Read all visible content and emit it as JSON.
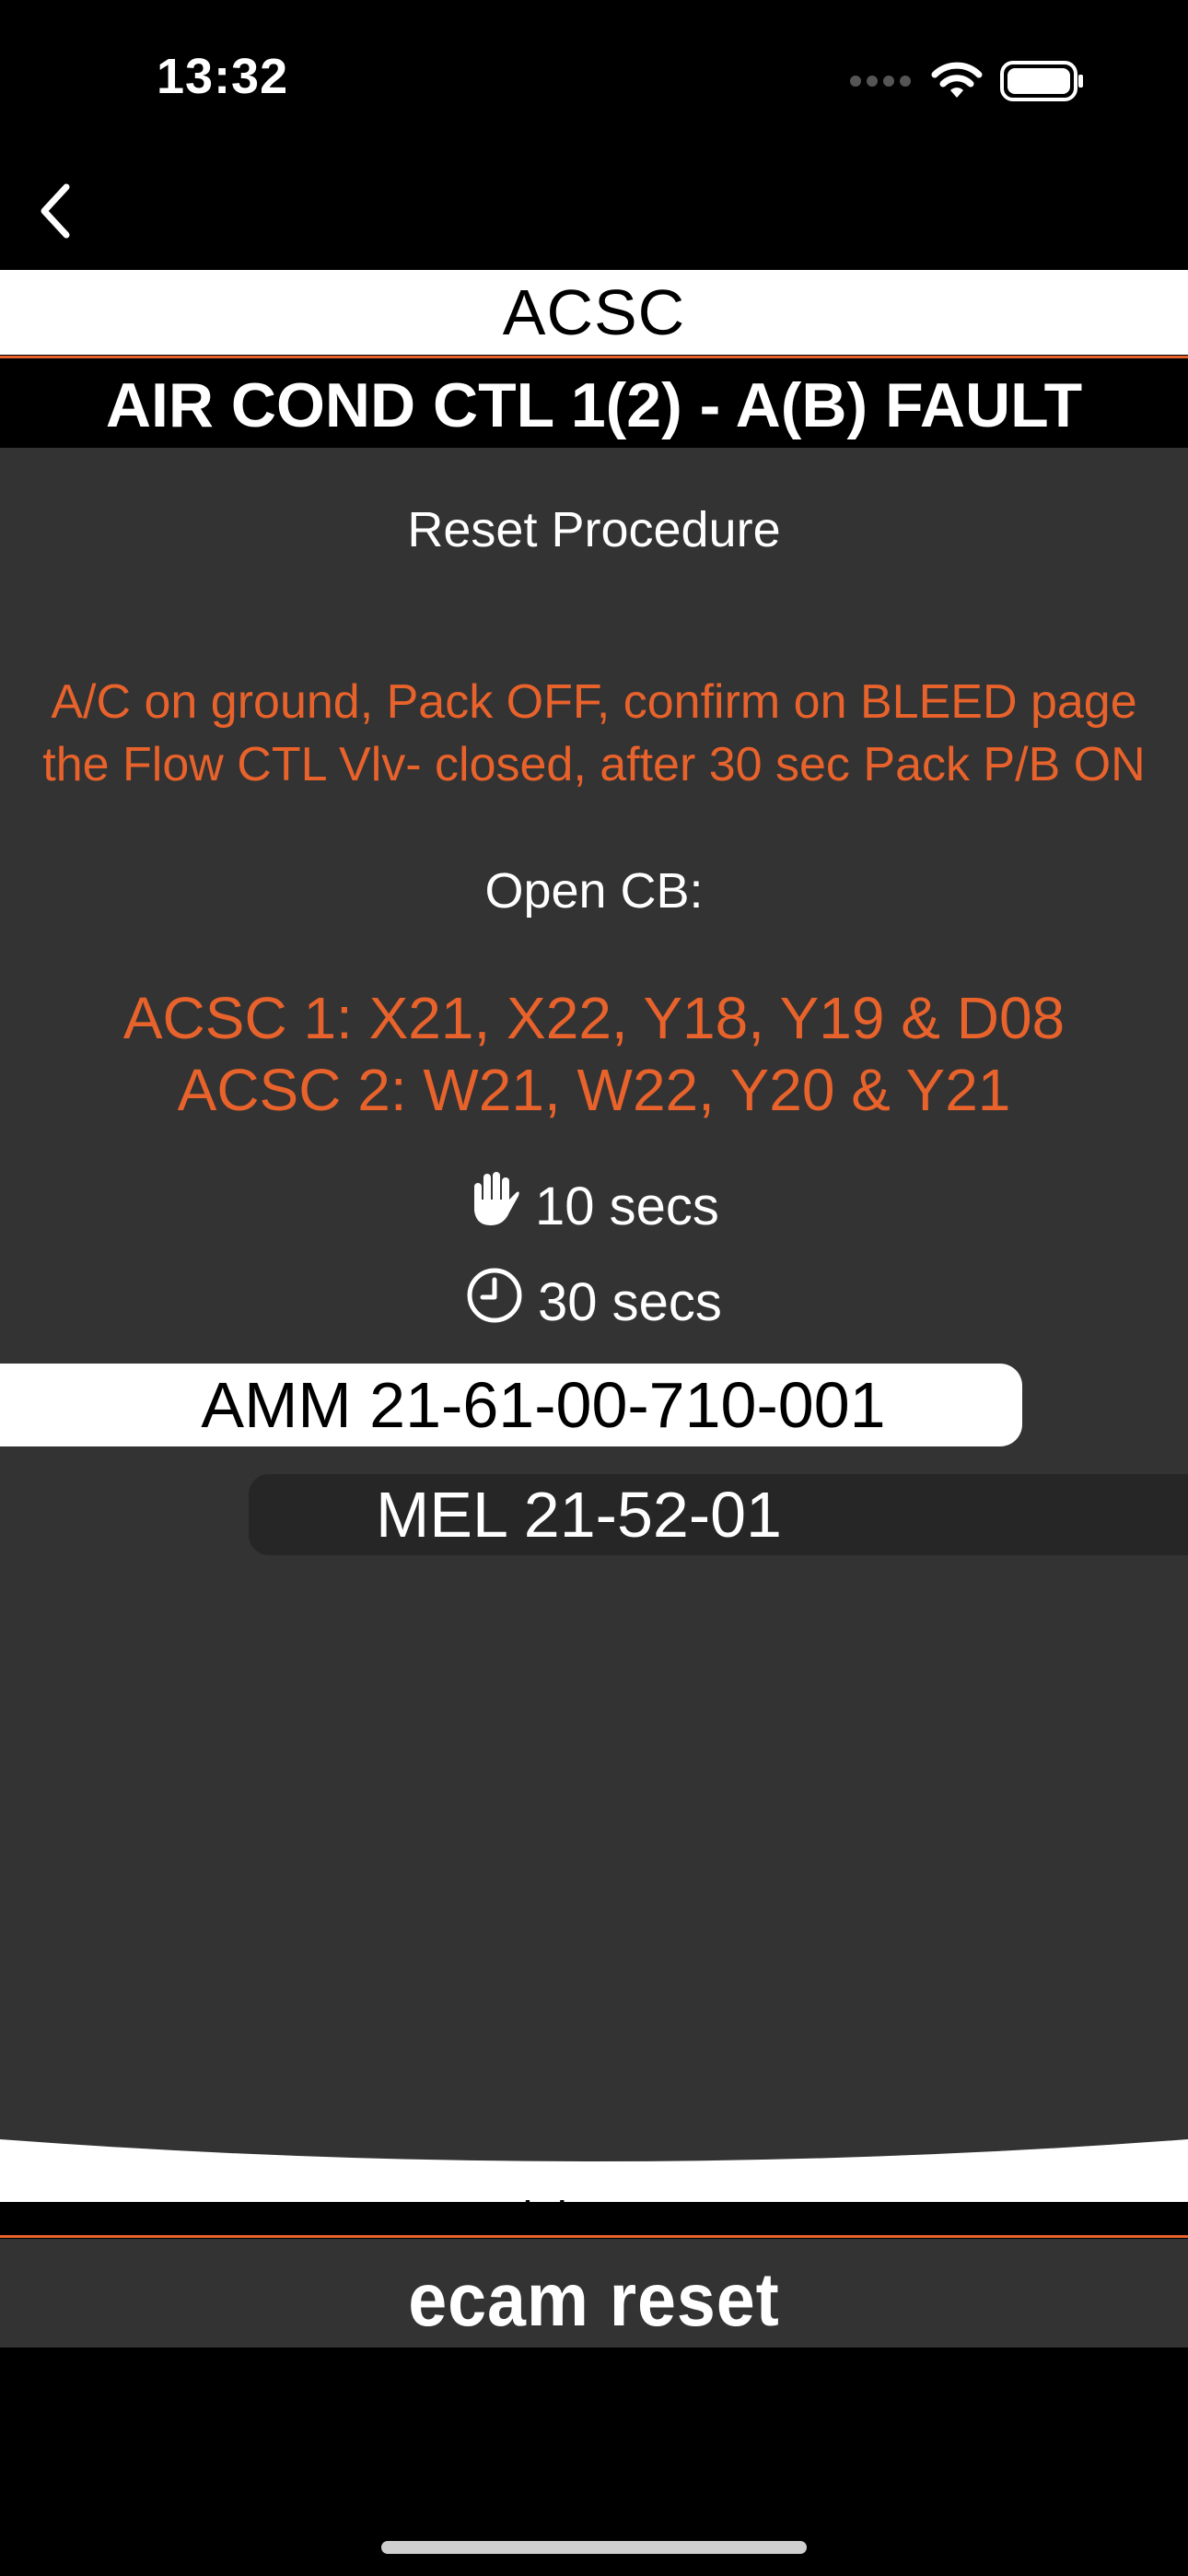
{
  "status_bar": {
    "time": "13:32",
    "icons": [
      "signal-dots-icon",
      "wifi-icon",
      "battery-icon"
    ]
  },
  "nav": {
    "back_icon": "chevron-left-icon"
  },
  "header": {
    "category": "ACSC",
    "fault": "AIR COND CTL 1(2) - A(B) FAULT"
  },
  "procedure": {
    "heading": "Reset Procedure",
    "instruction_line1": "A/C on ground, Pack OFF, confirm on BLEED page",
    "instruction_line2": "the Flow CTL Vlv- closed, after 30 sec Pack P/B ON",
    "open_cb_heading": "Open CB:",
    "cb_line1": "ACSC 1: X21, X22, Y18, Y19 & D08",
    "cb_line2": "ACSC 2: W21, W22, Y20 & Y21",
    "hold_time": "10 secs",
    "hold_icon": "hand-icon",
    "wait_time": "30 secs",
    "wait_icon": "clock-icon"
  },
  "references": {
    "amm": "AMM 21-61-00-710-001",
    "mel": "MEL 21-52-01"
  },
  "footer": {
    "club": "club cave",
    "brand": "ecam reset"
  },
  "colors": {
    "accent": "#e8622b",
    "content_bg": "#333333",
    "header_bg": "#000000"
  }
}
